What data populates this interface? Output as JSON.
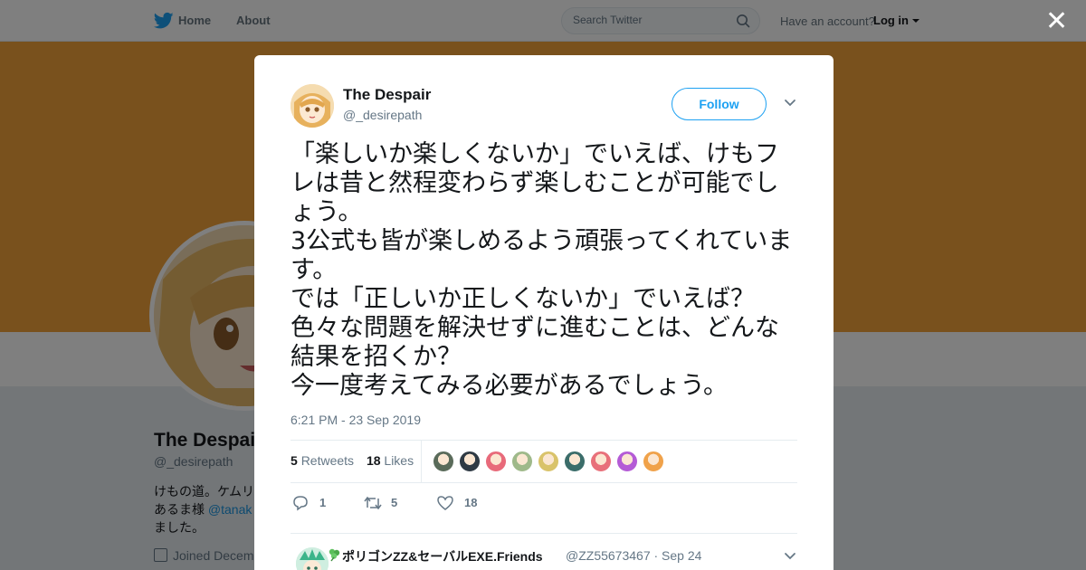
{
  "nav": {
    "home": "Home",
    "about": "About",
    "search_placeholder": "Search Twitter",
    "have_account": "Have an account?",
    "login": "Log in",
    "brand_color": "#1da1f2"
  },
  "profile_bg": {
    "name": "The Despair",
    "handle": "@_desirepath",
    "bio_line1": "けもの道。ケムリ",
    "bio_line2_pre": "あるま様",
    "bio_link": "@tanak",
    "bio_line3": "ました。",
    "joined": "Joined Decem",
    "banner_color": "#f2a33a"
  },
  "tweet": {
    "author_name": "The Despair",
    "author_handle": "@_desirepath",
    "follow_label": "Follow",
    "text": "「楽しいか楽しくないか」でいえば、けもフレは昔と然程変わらず楽しむことが可能でしょう。\n3公式も皆が楽しめるよう頑張ってくれています。\nでは「正しいか正しくないか」でいえば？\n色々な問題を解決せずに進むことは、どんな結果を招くか？\n今一度考えてみる必要があるでしょう。",
    "timestamp": "6:21 PM - 23 Sep 2019",
    "retweets_count": "5",
    "retweets_label": "Retweets",
    "likes_count": "18",
    "likes_label": "Likes",
    "reply_count": "1",
    "retweet_action_count": "5",
    "like_action_count": "18"
  },
  "likers": [
    {
      "color": "#5a6b5a"
    },
    {
      "color": "#2f3a44"
    },
    {
      "color": "#e86a7a"
    },
    {
      "color": "#9fb98a"
    },
    {
      "color": "#d9c36a"
    },
    {
      "color": "#3b6d6a"
    },
    {
      "color": "#e8707a"
    },
    {
      "color": "#b45bd6"
    },
    {
      "color": "#f0a24a"
    }
  ],
  "reply": {
    "name": "ポリゴンZZ&セーバルEXE.Friends",
    "handle": "@ZZ55673467",
    "date": "· Sep 24"
  }
}
